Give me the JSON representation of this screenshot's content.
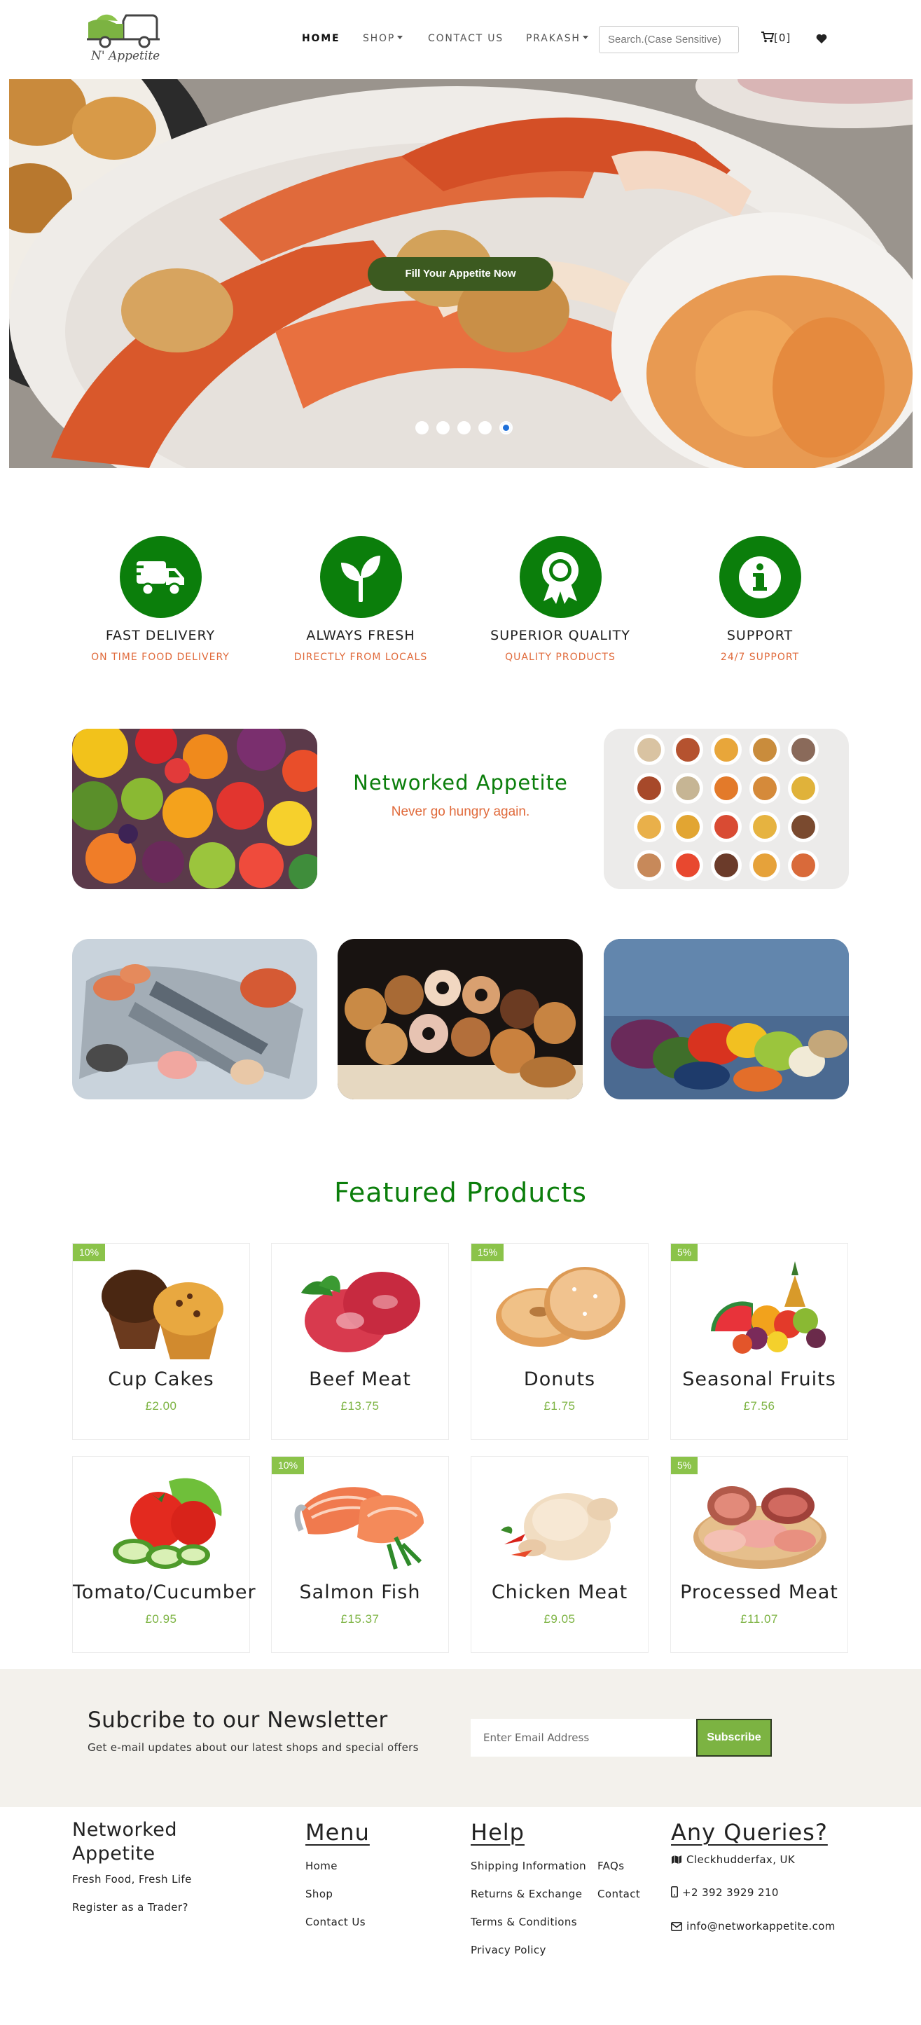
{
  "nav": {
    "logo_text": "N' Appetite",
    "links": [
      {
        "label": "HOME",
        "active": true
      },
      {
        "label": "SHOP",
        "dropdown": true
      },
      {
        "label": "CONTACT US"
      },
      {
        "label": "PRAKASH",
        "dropdown": true
      }
    ],
    "search_placeholder": "Search.(Case Sensitive)",
    "cart_label": "[0]",
    "icons": [
      "cart-icon",
      "heart-icon"
    ]
  },
  "hero": {
    "button_label": "Fill Your Appetite Now",
    "slide_count": 5,
    "active_slide": 5
  },
  "features": [
    {
      "icon": "truck-icon",
      "title": "FAST DELIVERY",
      "subtitle": "ON TIME FOOD DELIVERY"
    },
    {
      "icon": "leaf-icon",
      "title": "ALWAYS FRESH",
      "subtitle": "DIRECTLY FROM LOCALS"
    },
    {
      "icon": "award-icon",
      "title": "SUPERIOR QUALITY",
      "subtitle": "QUALITY PRODUCTS"
    },
    {
      "icon": "info-icon",
      "title": "SUPPORT",
      "subtitle": "24/7 SUPPORT"
    }
  ],
  "brand": {
    "name": "Networked Appetite",
    "tagline": "Never go hungry again."
  },
  "featured": {
    "heading": "Featured Products",
    "products": [
      {
        "name": "Cup Cakes",
        "price": "£2.00",
        "discount": "10%"
      },
      {
        "name": "Beef Meat",
        "price": "£13.75",
        "discount": ""
      },
      {
        "name": "Donuts",
        "price": "£1.75",
        "discount": "15%"
      },
      {
        "name": "Seasonal Fruits",
        "price": "£7.56",
        "discount": "5%"
      },
      {
        "name": "Tomato/Cucumber",
        "price": "£0.95",
        "discount": ""
      },
      {
        "name": "Salmon Fish",
        "price": "£15.37",
        "discount": "10%"
      },
      {
        "name": "Chicken Meat",
        "price": "£9.05",
        "discount": ""
      },
      {
        "name": "Processed Meat",
        "price": "£11.07",
        "discount": "5%"
      }
    ]
  },
  "newsletter": {
    "title": "Subcribe to our Newsletter",
    "subtitle": "Get e-mail updates about our latest shops and special offers",
    "input_placeholder": "Enter Email Address",
    "button_label": "Subscribe"
  },
  "footer": {
    "brand": "Networked Appetite",
    "tagline": "Fresh Food, Fresh Life",
    "trader_link": "Register as a Trader?",
    "menu_heading": "Menu",
    "menu_links": [
      "Home",
      "Shop",
      "Contact Us"
    ],
    "help_heading": "Help",
    "help_links": [
      "Shipping Information",
      "Returns & Exchange",
      "Terms & Conditions",
      "Privacy Policy"
    ],
    "help_links_2": [
      "FAQs",
      "Contact"
    ],
    "queries_heading": "Any Queries?",
    "address": "Cleckhudderfax, UK",
    "phone": "+2 392 3929 210",
    "email": "info@networkappetite.com"
  },
  "colors": {
    "primary_green": "#0b7e0b",
    "accent_orange": "#e06a3b",
    "price_green": "#7cb342",
    "newsletter_bg": "#f3f1ec"
  }
}
